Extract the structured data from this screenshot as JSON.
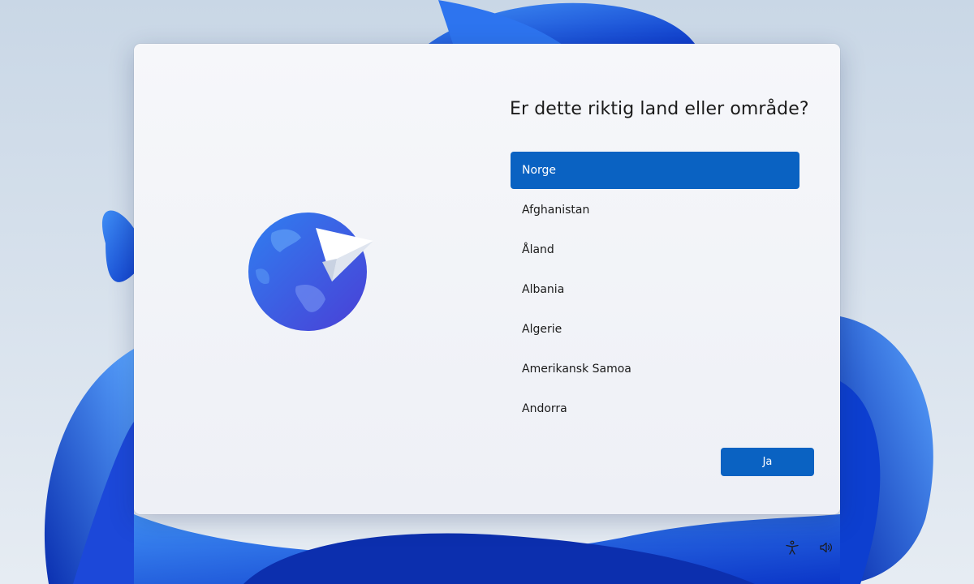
{
  "dialog": {
    "title": "Er dette riktig land eller område?",
    "countries": [
      {
        "label": "Norge",
        "selected": true
      },
      {
        "label": "Afghanistan",
        "selected": false
      },
      {
        "label": "Åland",
        "selected": false
      },
      {
        "label": "Albania",
        "selected": false
      },
      {
        "label": "Algerie",
        "selected": false
      },
      {
        "label": "Amerikansk Samoa",
        "selected": false
      },
      {
        "label": "Andorra",
        "selected": false
      }
    ],
    "confirm_label": "Ja"
  },
  "system_tray": {
    "icons": [
      "accessibility-icon",
      "volume-icon"
    ]
  },
  "colors": {
    "accent": "#0a62c2",
    "background_blue": "#1a56d8"
  }
}
